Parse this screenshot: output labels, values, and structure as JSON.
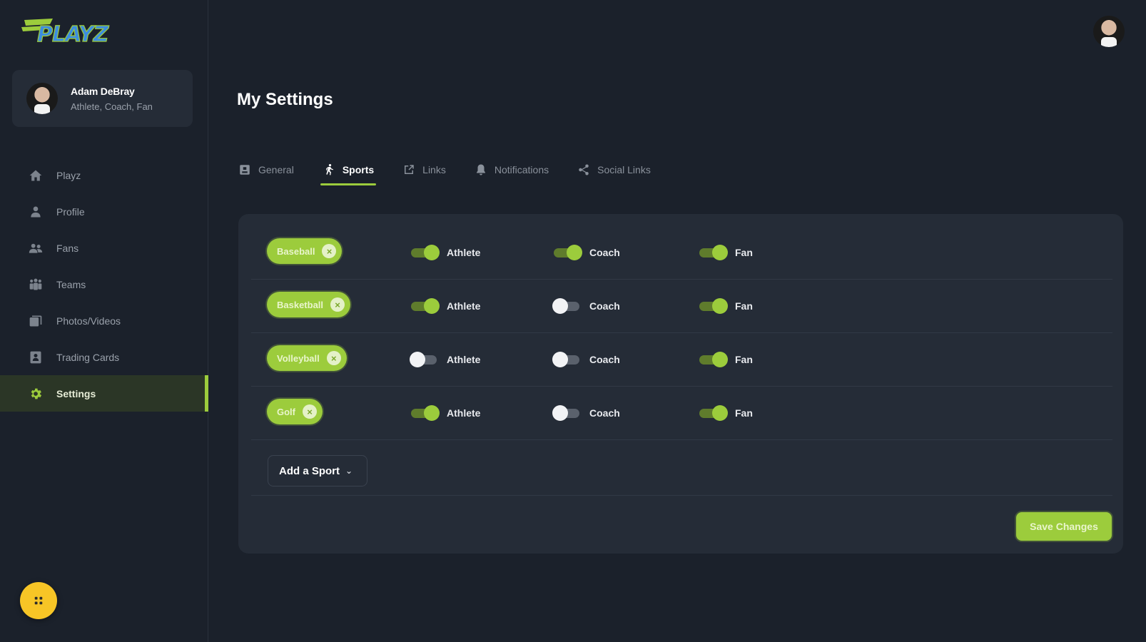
{
  "brand": {
    "logo_text": "PLAYZ",
    "accent": "#9ccc3c",
    "fab_color": "#f7c526"
  },
  "user": {
    "name": "Adam DeBray",
    "roles": "Athlete, Coach, Fan"
  },
  "sidebar": {
    "items": [
      {
        "label": "Playz",
        "icon": "home-icon",
        "active": false
      },
      {
        "label": "Profile",
        "icon": "user-icon",
        "active": false
      },
      {
        "label": "Fans",
        "icon": "fans-icon",
        "active": false
      },
      {
        "label": "Teams",
        "icon": "teams-icon",
        "active": false
      },
      {
        "label": "Photos/Videos",
        "icon": "photos-icon",
        "active": false
      },
      {
        "label": "Trading Cards",
        "icon": "trading-card-icon",
        "active": false
      },
      {
        "label": "Settings",
        "icon": "gear-icon",
        "active": true
      }
    ]
  },
  "page": {
    "title": "My Settings"
  },
  "tabs": [
    {
      "label": "General",
      "icon": "general-icon",
      "active": false
    },
    {
      "label": "Sports",
      "icon": "runner-icon",
      "active": true
    },
    {
      "label": "Links",
      "icon": "external-link-icon",
      "active": false
    },
    {
      "label": "Notifications",
      "icon": "bell-icon",
      "active": false
    },
    {
      "label": "Social Links",
      "icon": "share-icon",
      "active": false
    }
  ],
  "sports": [
    {
      "name": "Baseball",
      "athlete": true,
      "coach": true,
      "fan": true
    },
    {
      "name": "Basketball",
      "athlete": true,
      "coach": false,
      "fan": true
    },
    {
      "name": "Volleyball",
      "athlete": false,
      "coach": false,
      "fan": true
    },
    {
      "name": "Golf",
      "athlete": true,
      "coach": false,
      "fan": true
    }
  ],
  "role_labels": {
    "athlete": "Athlete",
    "coach": "Coach",
    "fan": "Fan"
  },
  "actions": {
    "add_sport": "Add a Sport",
    "save": "Save Changes"
  }
}
